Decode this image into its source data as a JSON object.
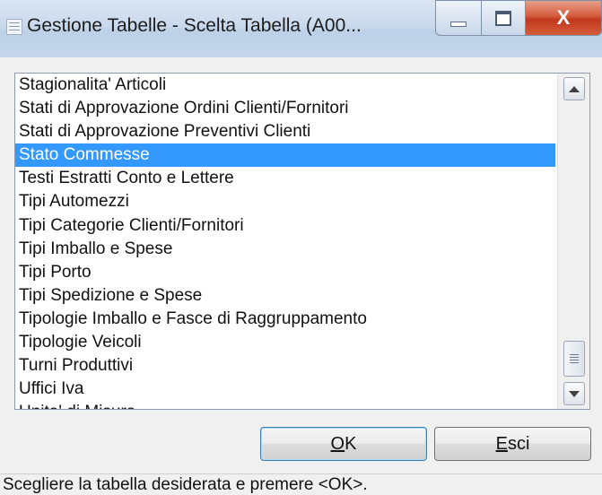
{
  "window": {
    "title": "Gestione Tabelle - Scelta Tabella (A00...",
    "close_glyph": "X"
  },
  "list": {
    "items": [
      "Stagionalita' Articoli",
      "Stati di Approvazione Ordini Clienti/Fornitori",
      "Stati di Approvazione Preventivi Clienti",
      "Stato Commesse",
      "Testi Estratti Conto e Lettere",
      "Tipi Automezzi",
      "Tipi Categorie Clienti/Fornitori",
      "Tipi Imballo e Spese",
      "Tipi Porto",
      "Tipi Spedizione e Spese",
      "Tipologie Imballo e Fasce di Raggruppamento",
      "Tipologie Veicoli",
      "Turni Produttivi",
      "Uffici Iva",
      "Unita' di Misura"
    ],
    "selected_index": 3,
    "selected_color": "#3399ff"
  },
  "buttons": {
    "ok_mnemonic": "O",
    "ok_rest": "K",
    "esci_mnemonic": "E",
    "esci_rest": "sci"
  },
  "status": {
    "text": "Scegliere la tabella desiderata e premere <OK>."
  }
}
